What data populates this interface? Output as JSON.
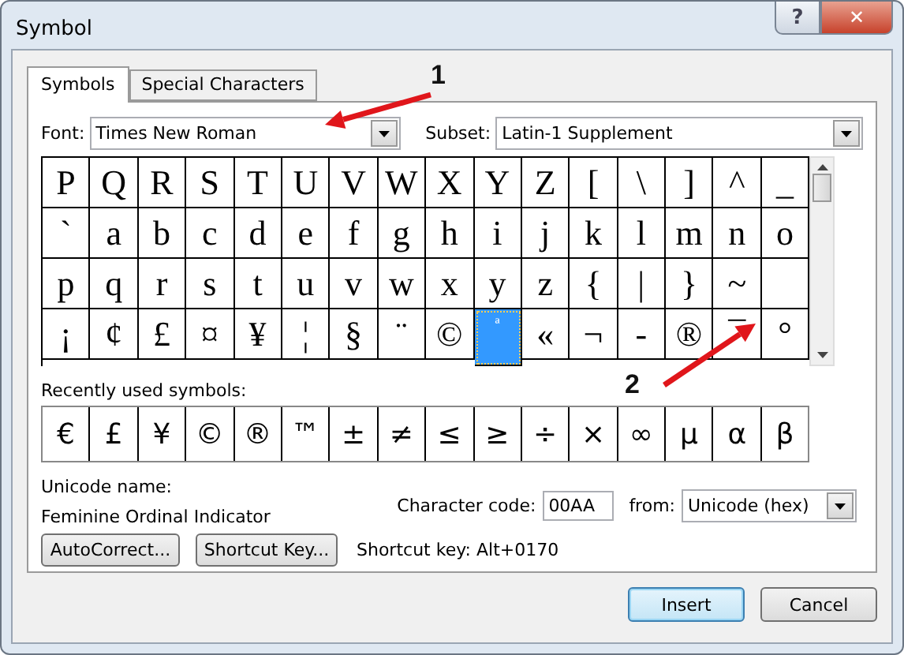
{
  "window": {
    "title": "Symbol"
  },
  "title_buttons": [
    {
      "kind": "help",
      "label": "?"
    },
    {
      "kind": "close",
      "label": "✕"
    }
  ],
  "tabs": [
    {
      "label": "Symbols",
      "selected": true
    },
    {
      "label": "Special Characters",
      "selected": false
    }
  ],
  "font": {
    "label": "Font:",
    "value": "Times New Roman"
  },
  "subset": {
    "label": "Subset:",
    "value": "Latin-1 Supplement"
  },
  "grid": [
    {
      "cells": [
        {
          "char": "P",
          "selected": false
        },
        {
          "char": "Q",
          "selected": false
        },
        {
          "char": "R",
          "selected": false
        },
        {
          "char": "S",
          "selected": false
        },
        {
          "char": "T",
          "selected": false
        },
        {
          "char": "U",
          "selected": false
        },
        {
          "char": "V",
          "selected": false
        },
        {
          "char": "W",
          "selected": false
        },
        {
          "char": "X",
          "selected": false
        },
        {
          "char": "Y",
          "selected": false
        },
        {
          "char": "Z",
          "selected": false
        },
        {
          "char": "[",
          "selected": false
        },
        {
          "char": "\\",
          "selected": false
        },
        {
          "char": "]",
          "selected": false
        },
        {
          "char": "^",
          "selected": false
        },
        {
          "char": "_",
          "selected": false
        }
      ]
    },
    {
      "cells": [
        {
          "char": "`",
          "selected": false
        },
        {
          "char": "a",
          "selected": false
        },
        {
          "char": "b",
          "selected": false
        },
        {
          "char": "c",
          "selected": false
        },
        {
          "char": "d",
          "selected": false
        },
        {
          "char": "e",
          "selected": false
        },
        {
          "char": "f",
          "selected": false
        },
        {
          "char": "g",
          "selected": false
        },
        {
          "char": "h",
          "selected": false
        },
        {
          "char": "i",
          "selected": false
        },
        {
          "char": "j",
          "selected": false
        },
        {
          "char": "k",
          "selected": false
        },
        {
          "char": "l",
          "selected": false
        },
        {
          "char": "m",
          "selected": false
        },
        {
          "char": "n",
          "selected": false
        },
        {
          "char": "o",
          "selected": false
        }
      ]
    },
    {
      "cells": [
        {
          "char": "p",
          "selected": false
        },
        {
          "char": "q",
          "selected": false
        },
        {
          "char": "r",
          "selected": false
        },
        {
          "char": "s",
          "selected": false
        },
        {
          "char": "t",
          "selected": false
        },
        {
          "char": "u",
          "selected": false
        },
        {
          "char": "v",
          "selected": false
        },
        {
          "char": "w",
          "selected": false
        },
        {
          "char": "x",
          "selected": false
        },
        {
          "char": "y",
          "selected": false
        },
        {
          "char": "z",
          "selected": false
        },
        {
          "char": "{",
          "selected": false
        },
        {
          "char": "|",
          "selected": false
        },
        {
          "char": "}",
          "selected": false
        },
        {
          "char": "~",
          "selected": false
        }
      ]
    },
    {
      "cells": [
        {
          "char": "¡",
          "selected": false
        },
        {
          "char": "¢",
          "selected": false
        },
        {
          "char": "£",
          "selected": false
        },
        {
          "char": "¤",
          "selected": false
        },
        {
          "char": "¥",
          "selected": false
        },
        {
          "char": "¦",
          "selected": false
        },
        {
          "char": "§",
          "selected": false
        },
        {
          "char": "¨",
          "selected": false
        },
        {
          "char": "©",
          "selected": false
        },
        {
          "char": "ª",
          "selected": true
        },
        {
          "char": "«",
          "selected": false
        },
        {
          "char": "¬",
          "selected": false
        },
        {
          "char": "-",
          "selected": false
        },
        {
          "char": "®",
          "selected": false
        },
        {
          "char": "¯",
          "selected": false
        },
        {
          "char": "°",
          "selected": false
        }
      ]
    }
  ],
  "recent": {
    "label": "Recently used symbols:",
    "symbols": [
      "€",
      "£",
      "¥",
      "©",
      "®",
      "™",
      "±",
      "≠",
      "≤",
      "≥",
      "÷",
      "×",
      "∞",
      "µ",
      "α",
      "β"
    ]
  },
  "unicode_name": {
    "label": "Unicode name:",
    "value": "Feminine Ordinal Indicator"
  },
  "character_code": {
    "label": "Character code:",
    "value": "00AA"
  },
  "from": {
    "label": "from:",
    "value": "Unicode (hex)"
  },
  "autocorrect_button": "AutoCorrect...",
  "shortcut_key_button": "Shortcut Key...",
  "shortcut_key": "Shortcut key: Alt+0170",
  "buttons": [
    {
      "label": "Insert",
      "default": true
    },
    {
      "label": "Cancel",
      "default": false
    }
  ],
  "annotations": [
    {
      "label": "1"
    },
    {
      "label": "2"
    }
  ]
}
